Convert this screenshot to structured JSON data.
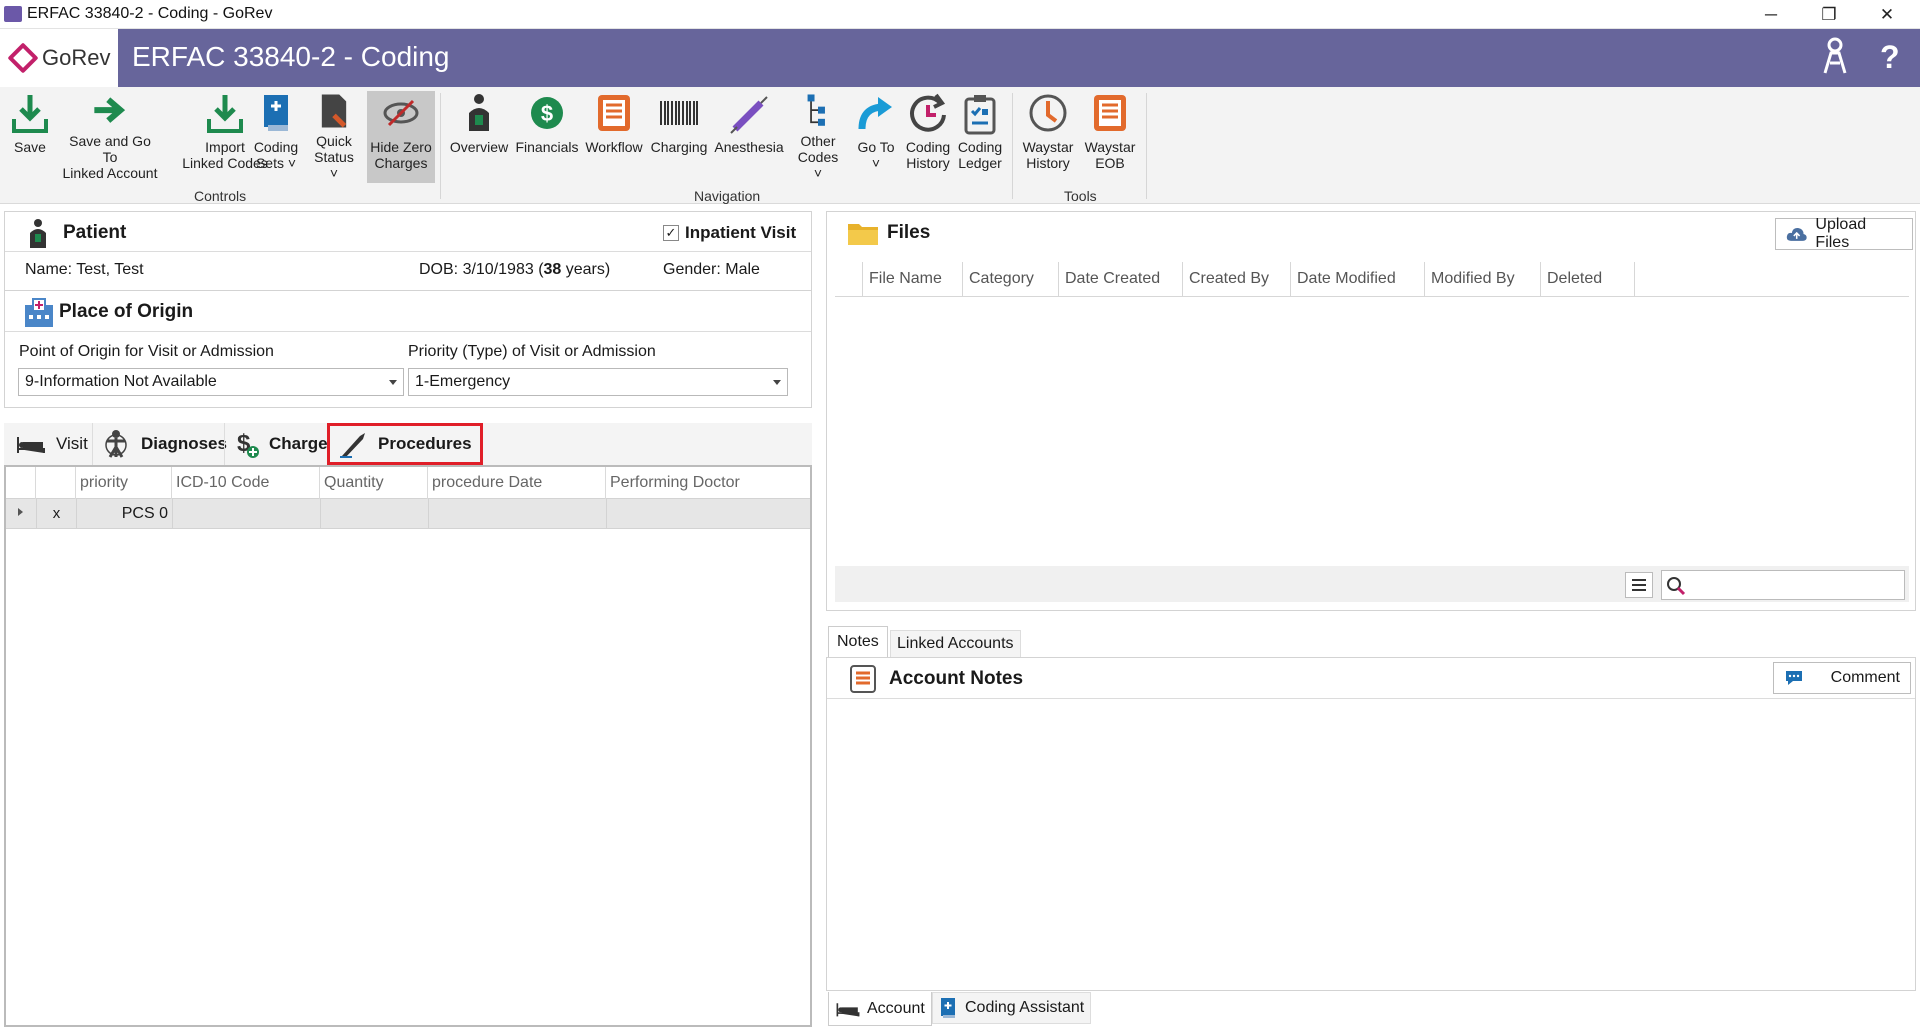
{
  "window": {
    "title": "ERFAC 33840-2 - Coding - GoRev",
    "minimize_glyph": "─",
    "restore_glyph": "❐",
    "close_glyph": "✕"
  },
  "header": {
    "brand": "GoRev",
    "title": "ERFAC 33840-2 - Coding",
    "help_glyph": "?",
    "colors": {
      "bar": "#67659b",
      "brand": "#c2206a"
    }
  },
  "ribbon": {
    "groups": {
      "controls": "Controls",
      "navigation": "Navigation",
      "tools": "Tools"
    },
    "buttons": {
      "save": "Save",
      "save_goto_1": "Save and Go To",
      "save_goto_2": "Linked Account",
      "import_1": "Import",
      "import_2": "Linked Codes",
      "coding_sets_1": "Coding",
      "coding_sets_2": "Sets",
      "quick_status_1": "Quick",
      "quick_status_2": "Status",
      "hide_zero_1": "Hide Zero",
      "hide_zero_2": "Charges",
      "overview": "Overview",
      "financials": "Financials",
      "workflow": "Workflow",
      "charging": "Charging",
      "anesthesia": "Anesthesia",
      "other_codes_1": "Other",
      "other_codes_2": "Codes",
      "goto": "Go To",
      "coding_history_1": "Coding",
      "coding_history_2": "History",
      "coding_ledger_1": "Coding",
      "coding_ledger_2": "Ledger",
      "waystar_history_1": "Waystar",
      "waystar_history_2": "History",
      "waystar_eob_1": "Waystar",
      "waystar_eob_2": "EOB"
    },
    "icons": [
      "save-icon",
      "save-goto-icon",
      "import-icon",
      "coding-sets-icon",
      "quick-status-icon",
      "hide-zero-icon",
      "overview-icon",
      "financials-icon",
      "workflow-icon",
      "charging-icon",
      "anesthesia-icon",
      "other-codes-icon",
      "goto-icon",
      "coding-history-icon",
      "coding-ledger-icon",
      "waystar-history-icon",
      "waystar-eob-icon"
    ]
  },
  "patient": {
    "heading": "Patient",
    "inpatient_label": "Inpatient Visit",
    "inpatient_checked": true,
    "name": "Name: Test, Test",
    "dob_prefix": "DOB: 3/10/1983 (",
    "age": "38",
    "dob_suffix": " years)",
    "gender": "Gender: Male"
  },
  "origin": {
    "heading": "Place of Origin",
    "point_label": "Point of Origin for Visit or Admission",
    "point_value": "9-Information Not Available",
    "priority_label": "Priority (Type) of Visit or Admission",
    "priority_value": "1-Emergency"
  },
  "tabs": {
    "visit": "Visit",
    "diagnoses": "Diagnoses",
    "charges": "Charges",
    "procedures": "Procedures",
    "selected": "procedures",
    "highlight_color": "#e01e28"
  },
  "procedures_grid": {
    "columns": [
      "priority",
      "ICD-10 Code",
      "Quantity",
      "procedure Date",
      "Performing Doctor"
    ],
    "rows": [
      {
        "delete": "x",
        "priority": "PCS 0",
        "icd10": "",
        "quantity": "",
        "date": "",
        "doctor": ""
      }
    ]
  },
  "files": {
    "heading": "Files",
    "upload_label": "Upload Files",
    "columns": [
      "File Name",
      "Category",
      "Date Created",
      "Created By",
      "Date Modified",
      "Modified By",
      "Deleted"
    ],
    "search_value": ""
  },
  "notes": {
    "tabs": [
      "Notes",
      "Linked Accounts"
    ],
    "heading": "Account Notes",
    "comment_label": "Comment"
  },
  "bottom_tabs": {
    "account": "Account",
    "coding_assistant": "Coding Assistant"
  }
}
